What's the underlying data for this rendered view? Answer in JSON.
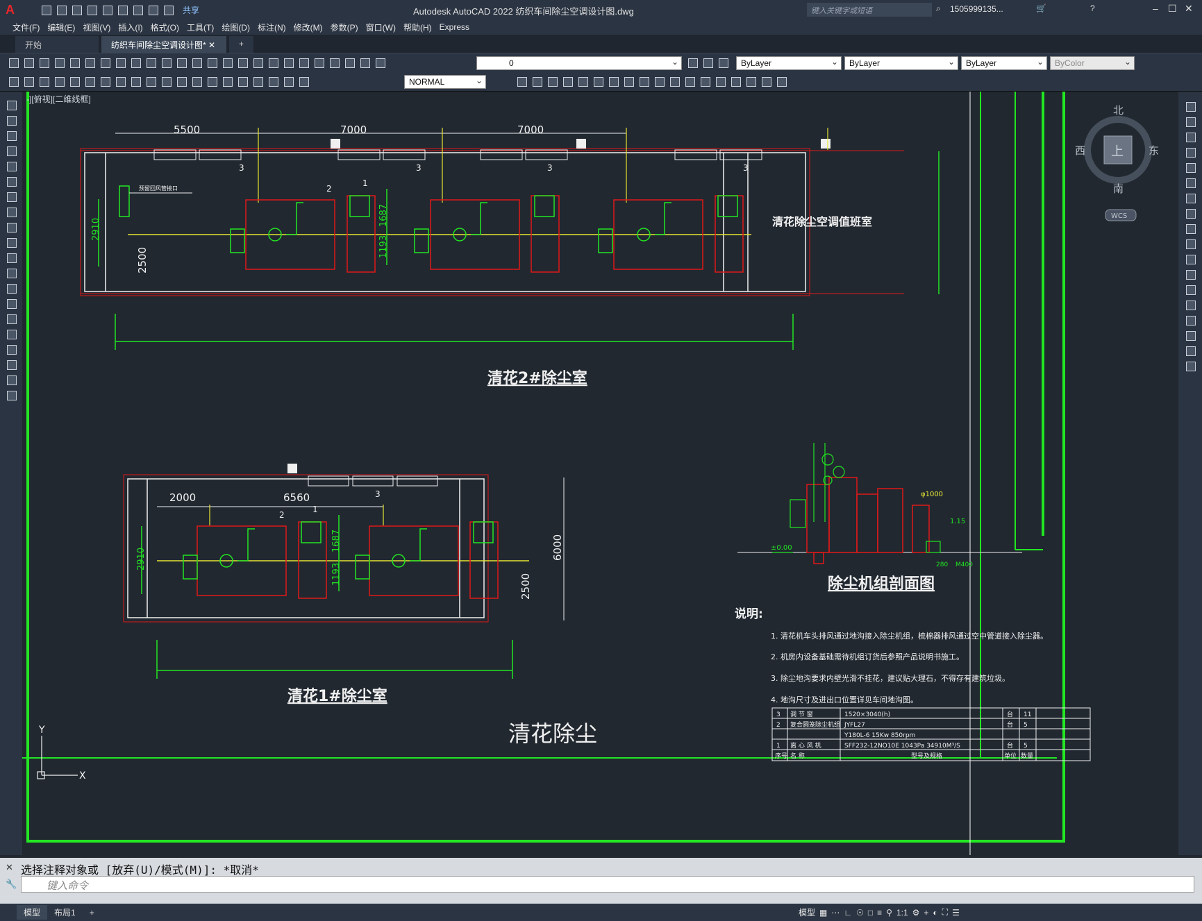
{
  "app": {
    "logo": "A",
    "title": "Autodesk AutoCAD 2022    纺织车间除尘空调设计图.dwg",
    "share_label": "共享",
    "search_placeholder": "键入关键字或短语",
    "user": "1505999135...",
    "help": "?"
  },
  "menu": [
    "文件(F)",
    "编辑(E)",
    "视图(V)",
    "插入(I)",
    "格式(O)",
    "工具(T)",
    "绘图(D)",
    "标注(N)",
    "修改(M)",
    "参数(P)",
    "窗口(W)",
    "帮助(H)",
    "Express"
  ],
  "tabs": [
    {
      "label": "开始",
      "active": false
    },
    {
      "label": "纺织车间除尘空调设计图*",
      "active": true
    }
  ],
  "toolbar": {
    "layer_value": "0",
    "color_value": "ByLayer",
    "linetype_value": "ByLayer",
    "lineweight_value": "ByLayer",
    "plotstyle_value": "ByColor",
    "dimstyle_value": "NORMAL"
  },
  "viewport": {
    "label": "-][俯视][二维线框]",
    "viewcube": {
      "north": "北",
      "south": "南",
      "east": "东",
      "west": "西",
      "top": "上",
      "wcs": "WCS"
    }
  },
  "drawing": {
    "room2_title": "清花2#除尘室",
    "room1_title": "清花1#除尘室",
    "section_title": "除尘机组剖面图",
    "main_title": "清花除尘",
    "duty_room": "清花除尘空调值班室",
    "notes_title": "说明:",
    "notes": [
      "1. 清花机车头排风通过地沟接入除尘机组，梳棉器排风通过空中管道接入除尘器。",
      "2. 机房内设备基础需待机组订货后参照产品说明书施工。",
      "3. 除尘地沟要求内壁光滑不挂花，建议贴大理石，不得存有建筑垃圾。",
      "4. 地沟尺寸及进出口位置详见车间地沟图。"
    ],
    "dims_room2": [
      "5500",
      "7000",
      "7000",
      "2910",
      "2500",
      "1687",
      "1193"
    ],
    "dims_room1": [
      "2000",
      "6560",
      "2910",
      "1687",
      "1193",
      "2500",
      "6000"
    ],
    "markers": [
      "1",
      "2",
      "3"
    ],
    "section_labels": [
      "φ1000",
      "±0.00",
      "1.15",
      "280 ",
      "M400"
    ],
    "small_label": "预留回风管接口",
    "table": [
      [
        "3",
        "调 节 窗",
        "1520×3040(h)",
        "台",
        "11"
      ],
      [
        "2",
        "复合圆笼除尘机组",
        "JYFL27",
        "台",
        "5"
      ],
      [
        "",
        "",
        "Y180L-6   15Kw        850rpm",
        "",
        ""
      ],
      [
        "1",
        "离 心 风 机",
        "SFF232-12NO10E    1043Pa     34910M³/S",
        "台",
        "5"
      ],
      [
        "序号",
        "名        称",
        "型号及规格",
        "单位",
        "数量"
      ]
    ],
    "axis_x": "X",
    "axis_y": "Y"
  },
  "command": {
    "history": "选择注释对象或 [放弃(U)/模式(M)]: *取消*",
    "placeholder": "键入命令"
  },
  "status": {
    "tabs": [
      {
        "label": "模型",
        "active": true
      },
      {
        "label": "布局1",
        "active": false
      }
    ],
    "model_label": "模型",
    "scale": "1:1"
  },
  "colors": {
    "red": "#e01818",
    "green": "#22e622",
    "yellow": "#e6e633",
    "white": "#f0f0f0",
    "bg": "#212830"
  }
}
